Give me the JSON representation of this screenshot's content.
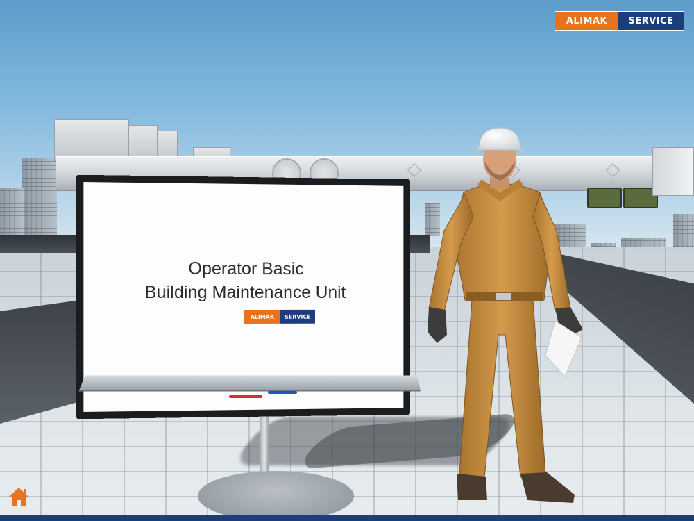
{
  "brand": {
    "part1": "ALIMAK",
    "part2": "SERVICE",
    "orange": "#e8731e",
    "navy": "#1d3c7c"
  },
  "board": {
    "title_line1": "Operator Basic",
    "title_line2": "Building Maintenance Unit"
  },
  "navigation": {
    "home_icon": "home-icon"
  }
}
